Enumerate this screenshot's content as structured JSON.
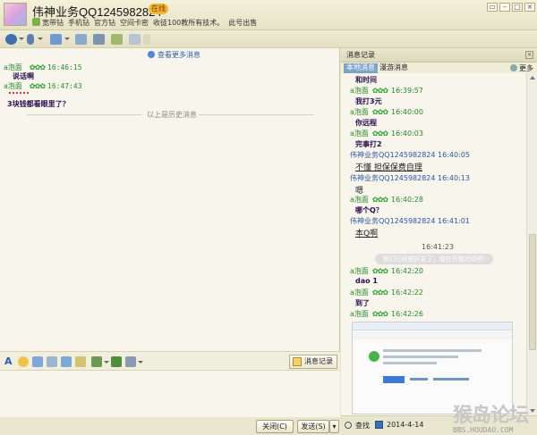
{
  "window": {
    "title": "伟神业务QQ1245982824",
    "status_badge": "在线",
    "signature_items": [
      "宽带钻",
      "手机钻",
      "官方钻",
      "空间卡密",
      "收徒100教所有技术。",
      "此号出售"
    ],
    "buttons": {
      "minimize": "–",
      "maximize": "□",
      "close": "×",
      "extra": "▭"
    }
  },
  "chat": {
    "more_link": "查看更多消息",
    "messages": [
      {
        "nick": "a泡面",
        "stars": "✿✿✿",
        "time": "16:46:15",
        "text": "说话啊"
      },
      {
        "nick": "a泡面",
        "stars": "✿✿✿",
        "time": "16:47:43",
        "text": "3块钱都看眼里了？"
      }
    ],
    "history_divider": "以上是历史消息"
  },
  "input_toolbar": {
    "history_button": "消息记录"
  },
  "bottom": {
    "close_button": "关闭(C)",
    "send_button": "发送(S)",
    "send_dropdown": "▾"
  },
  "history_panel": {
    "title": "消息记录",
    "close": "×",
    "tabs": [
      "本地消息",
      "漫游消息"
    ],
    "more": "更多",
    "entries": [
      {
        "type": "body",
        "text": "和时间"
      },
      {
        "type": "head",
        "who": "a泡面",
        "stars": "✿✿✿",
        "time": "16:39:57"
      },
      {
        "type": "body",
        "text": "我打3元"
      },
      {
        "type": "head",
        "who": "a泡面",
        "stars": "✿✿✿",
        "time": "16:40:00"
      },
      {
        "type": "body",
        "text": "你远程"
      },
      {
        "type": "head",
        "who": "a泡面",
        "stars": "✿✿✿",
        "time": "16:40:03"
      },
      {
        "type": "body",
        "text": "完事打2"
      },
      {
        "type": "headblue",
        "who": "伟神业务QQ1245982824",
        "time": "16:40:05"
      },
      {
        "type": "plainu",
        "text": "不懂  担保保费自理"
      },
      {
        "type": "headblue",
        "who": "伟神业务QQ1245982824",
        "time": "16:40:13"
      },
      {
        "type": "plain",
        "text": "嗯"
      },
      {
        "type": "head",
        "who": "a泡面",
        "stars": "✿✿✿",
        "time": "16:40:28"
      },
      {
        "type": "body",
        "text": "哪个Q？"
      },
      {
        "type": "headblue",
        "who": "伟神业务QQ1245982824",
        "time": "16:41:01"
      },
      {
        "type": "plainu",
        "text": "本Q啊"
      }
    ],
    "center_time": "16:41:23",
    "notice": "我们已经是好友了，现在开始对话吧!",
    "later": [
      {
        "type": "head",
        "who": "a泡面",
        "stars": "✿✿✿",
        "time": "16:42:20"
      },
      {
        "type": "body",
        "text": "dao  1"
      },
      {
        "type": "head",
        "who": "a泡面",
        "stars": "✿✿✿",
        "time": "16:42:22"
      },
      {
        "type": "body",
        "text": "到了"
      },
      {
        "type": "head",
        "who": "a泡面",
        "stars": "✿✿✿",
        "time": "16:42:26"
      }
    ],
    "footer": {
      "search": "查找",
      "date": "2014-4-14"
    }
  },
  "watermark": {
    "title": "猴岛论坛",
    "url": "BBS.HOUDAO.COM"
  },
  "colors": {
    "accent_green": "#2a8a2a",
    "accent_blue": "#2a56a5",
    "chrome": "#e9e6cf",
    "panel_bg": "#f7f5ec"
  }
}
